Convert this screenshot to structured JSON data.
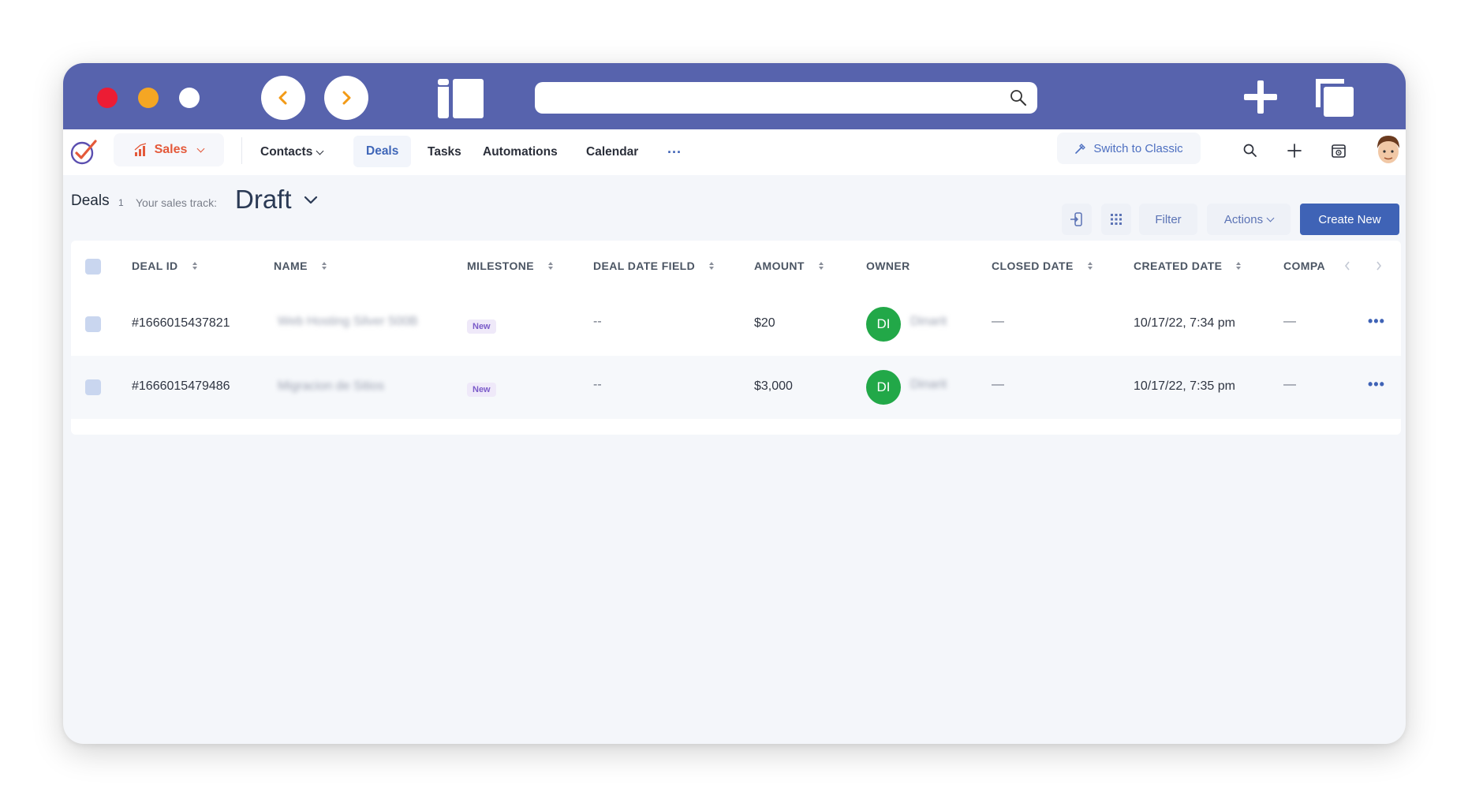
{
  "browser": {
    "url": ""
  },
  "nav": {
    "sales_label": "Sales",
    "links": [
      "Contacts",
      "Deals",
      "Tasks",
      "Automations",
      "Calendar"
    ],
    "more": "···",
    "switch_classic": "Switch to Classic"
  },
  "header": {
    "title": "Deals",
    "count": "1",
    "track_label": "Your sales track:",
    "track_value": "Draft",
    "filter_label": "Filter",
    "actions_label": "Actions",
    "create_label": "Create New"
  },
  "table": {
    "columns": [
      "DEAL ID",
      "NAME",
      "MILESTONE",
      "DEAL DATE FIELD",
      "AMOUNT",
      "OWNER",
      "CLOSED DATE",
      "CREATED DATE",
      "COMPA"
    ],
    "rows": [
      {
        "deal_id": "#1666015437821",
        "name": "Web Hosting Silver 500B",
        "milestone": "New",
        "deal_date": "--",
        "amount": "$20",
        "owner_initials": "DI",
        "owner_name": "Dinarit",
        "closed_date": "—",
        "created_date": "10/17/22, 7:34 pm",
        "company": "—"
      },
      {
        "deal_id": "#1666015479486",
        "name": "Migracion de Sitios",
        "milestone": "New",
        "deal_date": "--",
        "amount": "$3,000",
        "owner_initials": "DI",
        "owner_name": "Dinarit",
        "closed_date": "—",
        "created_date": "10/17/22, 7:35 pm",
        "company": "—"
      }
    ]
  },
  "colors": {
    "titlebar": "#5763ad",
    "primary": "#3f63b6",
    "sales": "#e4593a",
    "owner_avatar": "#22a848"
  }
}
